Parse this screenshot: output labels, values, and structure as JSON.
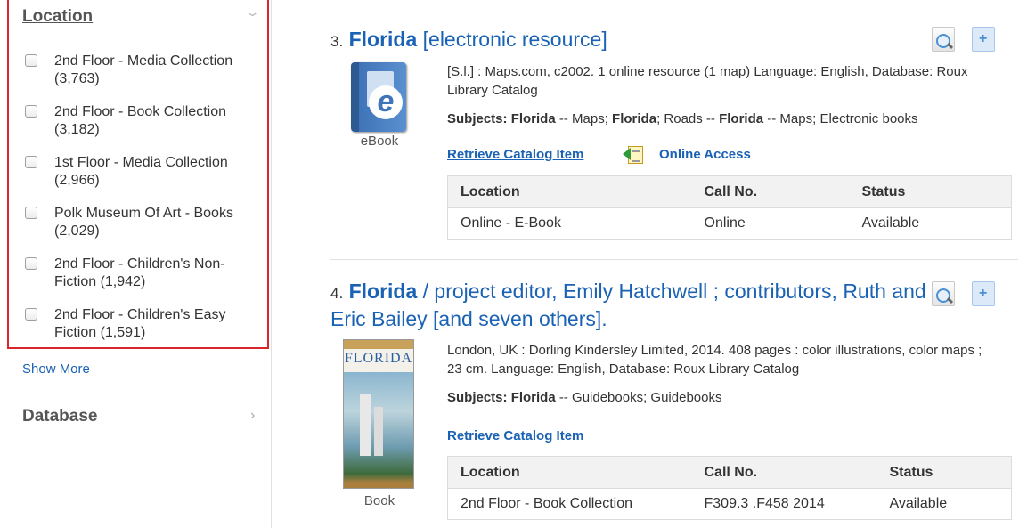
{
  "sidebar": {
    "location_heading": "Location",
    "facets": [
      {
        "label": "2nd Floor - Media Collection (3,763)"
      },
      {
        "label": "2nd Floor - Book Collection (3,182)"
      },
      {
        "label": "1st Floor - Media Collection (2,966)"
      },
      {
        "label": "Polk Museum Of Art - Books (2,029)"
      },
      {
        "label": "2nd Floor - Children's Non-Fiction (1,942)"
      },
      {
        "label": "2nd Floor - Children's Easy Fiction (1,591)"
      }
    ],
    "show_more": "Show More",
    "database_heading": "Database"
  },
  "results": [
    {
      "number": "3.",
      "title_bold": "Florida",
      "title_rest": " [electronic resource]",
      "format": "eBook",
      "description": "[S.l.] : Maps.com, c2002. 1 online resource (1 map) Language: English, Database: Roux Library Catalog",
      "subjects_label": "Subjects:",
      "subjects": [
        {
          "t": "Florida",
          "b": true
        },
        {
          "t": " -- Maps; ",
          "b": false
        },
        {
          "t": "Florida",
          "b": true
        },
        {
          "t": "; Roads -- ",
          "b": false
        },
        {
          "t": "Florida",
          "b": true
        },
        {
          "t": " -- Maps; Electronic books",
          "b": false
        }
      ],
      "retrieve_label": "Retrieve Catalog Item",
      "online_label": "Online Access",
      "table_headers": [
        "Location",
        "Call No.",
        "Status"
      ],
      "rows": [
        [
          "Online - E-Book",
          "Online",
          "Available"
        ]
      ]
    },
    {
      "number": "4.",
      "title_bold": "Florida",
      "title_rest": " / project editor, Emily Hatchwell ; contributors, Ruth and Eric Bailey [and seven others].",
      "format": "Book",
      "cover_title": "FLORIDA",
      "description": "London, UK : Dorling Kindersley Limited, 2014. 408 pages : color illustrations, color maps ; 23 cm. Language: English, Database: Roux Library Catalog",
      "subjects_label": "Subjects:",
      "subjects": [
        {
          "t": "Florida",
          "b": true
        },
        {
          "t": " -- Guidebooks; Guidebooks",
          "b": false
        }
      ],
      "retrieve_label": "Retrieve Catalog Item",
      "table_headers": [
        "Location",
        "Call No.",
        "Status"
      ],
      "rows": [
        [
          "2nd Floor - Book Collection",
          "F309.3 .F458 2014",
          "Available"
        ]
      ]
    }
  ]
}
